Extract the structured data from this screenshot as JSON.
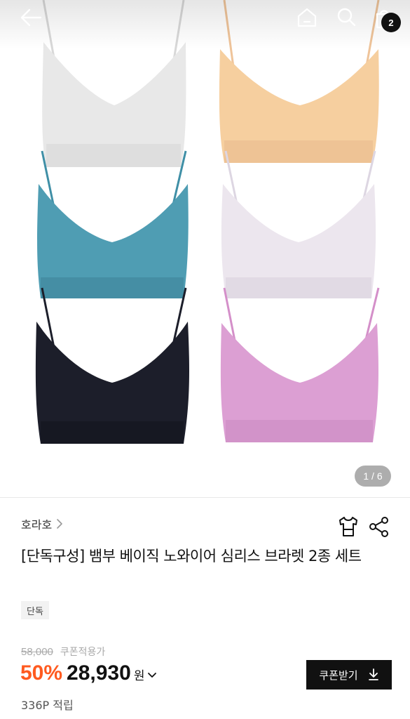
{
  "header": {
    "back_icon": "arrow-left-icon",
    "home_icon": "home-icon",
    "search_icon": "search-icon",
    "cart_icon": "shopping-bag-icon",
    "cart_count": "2"
  },
  "gallery": {
    "current": 1,
    "total": 6,
    "indicator": "1 / 6",
    "colors": [
      "#e9e9e9",
      "#f4cc9c",
      "#4b9bb1",
      "#ece6ee",
      "#1c1e2a",
      "#d99ad0"
    ]
  },
  "product": {
    "brand": "호라호",
    "title": "[단독구성] 뱀부 베이직 노와이어 심리스 브라렛 2종 세트",
    "tag": "단독",
    "original_price": "58,000",
    "coupon_note": "쿠폰적용가",
    "discount_rate": "50%",
    "price": "28,930",
    "currency": "원",
    "coupon_button": "쿠폰받기",
    "points": "336P 적립"
  },
  "colors": {
    "accent_discount": "#ff5a1f",
    "button_bg": "#111111"
  }
}
